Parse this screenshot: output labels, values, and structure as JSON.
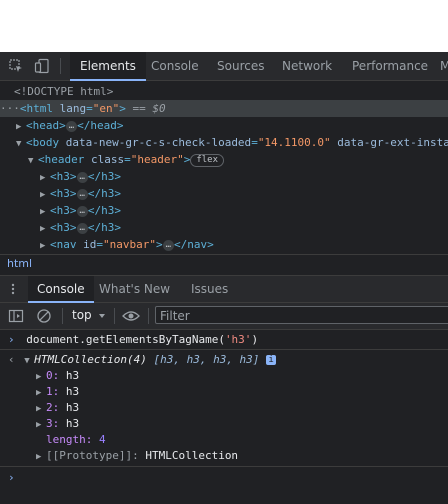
{
  "main_tabs": [
    "Elements",
    "Console",
    "Sources",
    "Network",
    "Performance",
    "M"
  ],
  "dom_tree": {
    "doctype": "<!DOCTYPE html>",
    "html_open": "<html",
    "html_attr": "lang",
    "html_val": "\"en\"",
    "html_close": ">",
    "html_marker": "== $0",
    "head": "<head>",
    "head_close": "</head>",
    "body_tag": "<body",
    "body_attr1": "data-new-gr-c-s-check-loaded",
    "body_val1": "\"14.1100.0\"",
    "body_attr2": "data-gr-ext-insta",
    "header_tag": "<header",
    "header_attr": "class",
    "header_val": "\"header\"",
    "header_gt": ">",
    "flex_badge": "flex",
    "h3_open": "<h3>",
    "h3_close": "</h3>",
    "ellipsis": "…",
    "nav_tag": "<nav",
    "nav_attr": "id",
    "nav_val": "\"navbar\"",
    "nav_gt": ">",
    "nav_close": "</nav>"
  },
  "breadcrumb": "html",
  "drawer_tabs": [
    "Console",
    "What's New",
    "Issues"
  ],
  "console_toolbar": {
    "context": "top",
    "filter_placeholder": "Filter"
  },
  "console": {
    "command_obj": "document.",
    "command_fn": "getElementsByTagName",
    "command_arg": "'h3'",
    "result_type": "HTMLCollection",
    "result_count": "(4)",
    "result_preview": "[h3, h3, h3, h3]",
    "items": [
      {
        "key": "0",
        "value": "h3"
      },
      {
        "key": "1",
        "value": "h3"
      },
      {
        "key": "2",
        "value": "h3"
      },
      {
        "key": "3",
        "value": "h3"
      }
    ],
    "length_key": "length",
    "length_value": "4",
    "prototype_key": "[[Prototype]]",
    "prototype_value": "HTMLCollection"
  },
  "colors": {
    "background": "#202124",
    "accent": "#8ab4f8",
    "tag": "#5db0d7",
    "attribute_value": "#f29766"
  },
  "icons": [
    "inspect-icon",
    "device-toggle-icon",
    "kebab-menu-icon",
    "sidebar-toggle-icon",
    "clear-console-icon",
    "eye-icon",
    "chevron-down-icon",
    "info-icon"
  ]
}
